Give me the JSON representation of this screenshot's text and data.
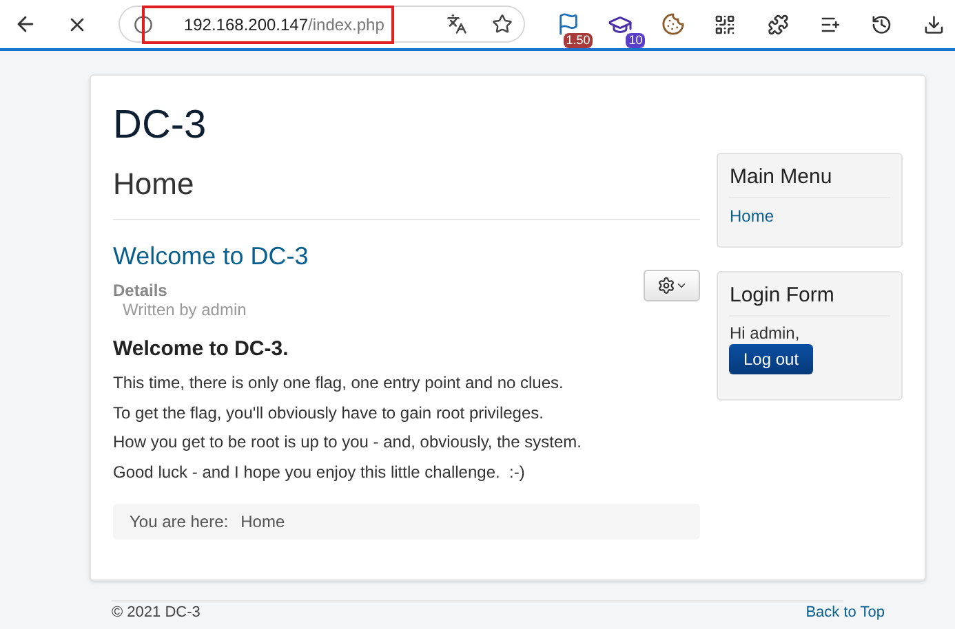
{
  "browser": {
    "url_host": "192.168.200.147",
    "url_path": "/index.php",
    "extensions": [
      {
        "kind": "flag",
        "badge": "1.50",
        "color": "#a83a3a"
      },
      {
        "kind": "cap",
        "badge": "10",
        "color": "#5b3ec8"
      },
      {
        "kind": "cookie"
      },
      {
        "kind": "qr"
      }
    ]
  },
  "site": {
    "title": "DC-3"
  },
  "page": {
    "heading": "Home"
  },
  "article": {
    "title": "Welcome to DC-3",
    "details_label": "Details",
    "author": "Written by admin",
    "subtitle": "Welcome to DC-3.",
    "paragraphs": [
      "This time, there is only one flag, one entry point and no clues.",
      "To get the flag, you'll obviously have to gain root privileges.",
      "How you get to be root is up to you - and, obviously, the system.",
      "Good luck - and I hope you enjoy this little challenge.  :-)"
    ]
  },
  "breadcrumb": {
    "label": "You are here:",
    "items": [
      "Home"
    ]
  },
  "main_menu": {
    "title": "Main Menu",
    "items": [
      "Home"
    ]
  },
  "login_form": {
    "title": "Login Form",
    "greeting": "Hi admin,",
    "button": "Log out"
  },
  "footer": {
    "copyright": "© 2021 DC-3",
    "back_to_top": "Back to Top"
  }
}
